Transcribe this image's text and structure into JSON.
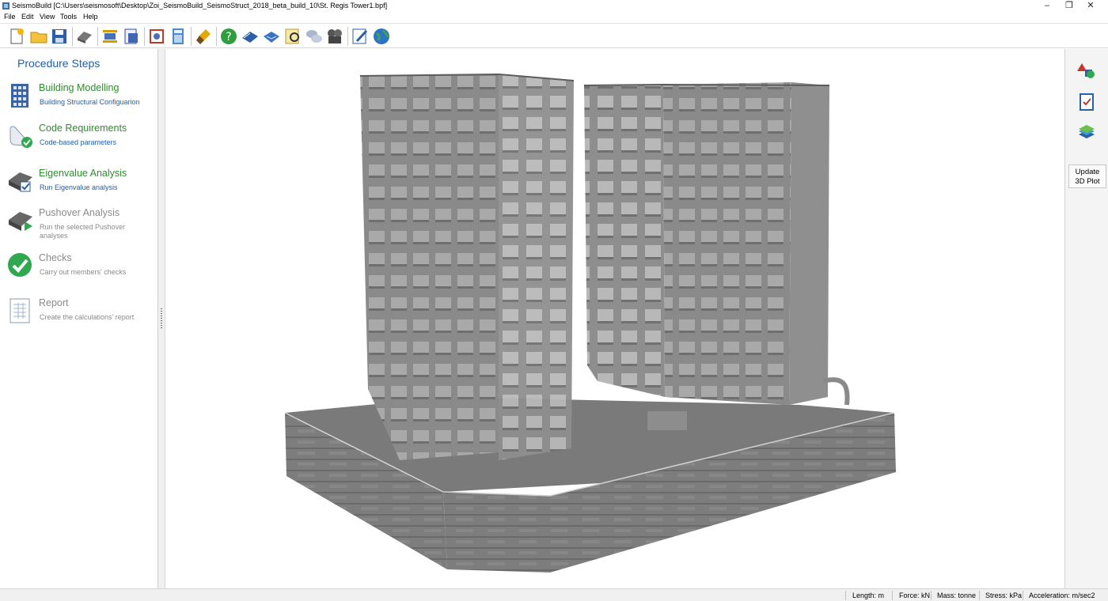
{
  "window": {
    "title": "SeismoBuild   [C:\\Users\\seismosoft\\Desktop\\Zoi_SeismoBuild_SeismoStruct_2018_beta_build_10\\St. Regis Tower1.bpf]",
    "minimize": "–",
    "restore": "❐",
    "close": "✕"
  },
  "menu": [
    "File",
    "Edit",
    "View",
    "Tools",
    "Help"
  ],
  "toolbar": {
    "buttons": [
      "new-file",
      "open-folder",
      "save",
      "properties",
      "fit-view",
      "print-preview",
      "model-settings",
      "calculator",
      "brush",
      "help",
      "book-blue",
      "book-open",
      "search-report",
      "cloud-chat",
      "film-camera",
      "edit-note",
      "globe"
    ]
  },
  "sidebar": {
    "heading": "Procedure Steps",
    "steps": [
      {
        "title": "Building Modelling",
        "desc": "Building Structural Configuarion",
        "icon": "building-icon",
        "enabled": true
      },
      {
        "title": "Code Requirements",
        "desc": "Code-based parameters",
        "icon": "scroll-check-icon",
        "enabled": true
      },
      {
        "title": "Eigenvalue Analysis",
        "desc": "Run Eigenvalue analysis",
        "icon": "eigenvalue-icon",
        "enabled": true
      },
      {
        "title": "Pushover Analysis",
        "desc": "Run the selected Pushover analyses",
        "icon": "pushover-icon",
        "enabled": false
      },
      {
        "title": "Checks",
        "desc": "Carry out members' checks",
        "icon": "checkmark-icon",
        "enabled": false
      },
      {
        "title": "Report",
        "desc": "Create the calculations' report",
        "icon": "report-icon",
        "enabled": false
      }
    ]
  },
  "rightpanel": {
    "buttons": [
      "shapes-icon",
      "checklist-icon",
      "layers-icon"
    ],
    "update_line1": "Update",
    "update_line2": "3D Plot"
  },
  "status": {
    "length": "Length: m",
    "force": "Force: kN",
    "mass": "Mass: tonne",
    "stress": "Stress: kPa",
    "acceleration": "Acceleration: m/sec2"
  },
  "colors": {
    "accent_blue": "#1f5fa8",
    "step_green": "#2e8b2e",
    "disabled_gray": "#8a8a8a",
    "concrete": "#8c8c8c"
  }
}
